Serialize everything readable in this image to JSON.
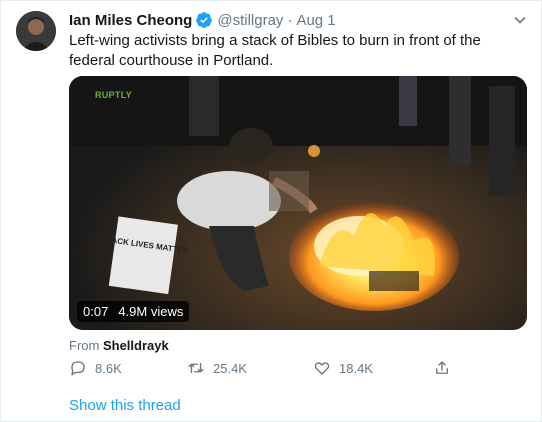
{
  "tweet": {
    "display_name": "Ian Miles Cheong",
    "handle": "@stillgray",
    "separator": "·",
    "date": "Aug 1",
    "text": "Left-wing activists bring a stack of Bibles to burn in front of the federal courthouse in Portland.",
    "verified_color": "#1da1f2"
  },
  "media": {
    "watermark": "RUPTLY",
    "duration": "0:07",
    "views": "4.9M views",
    "sign_text": "BLACK LIVES MATTER"
  },
  "source": {
    "prefix": "From",
    "name": "Shelldrayk"
  },
  "actions": {
    "reply_count": "8.6K",
    "retweet_count": "25.4K",
    "like_count": "18.4K"
  },
  "show_thread_label": "Show this thread",
  "icons": [
    "verified-badge-icon",
    "chevron-down-icon",
    "reply-icon",
    "retweet-icon",
    "like-icon",
    "share-icon"
  ],
  "colors": {
    "accent": "#1da1f2",
    "secondary_text": "#657786",
    "primary_text": "#14171a"
  }
}
